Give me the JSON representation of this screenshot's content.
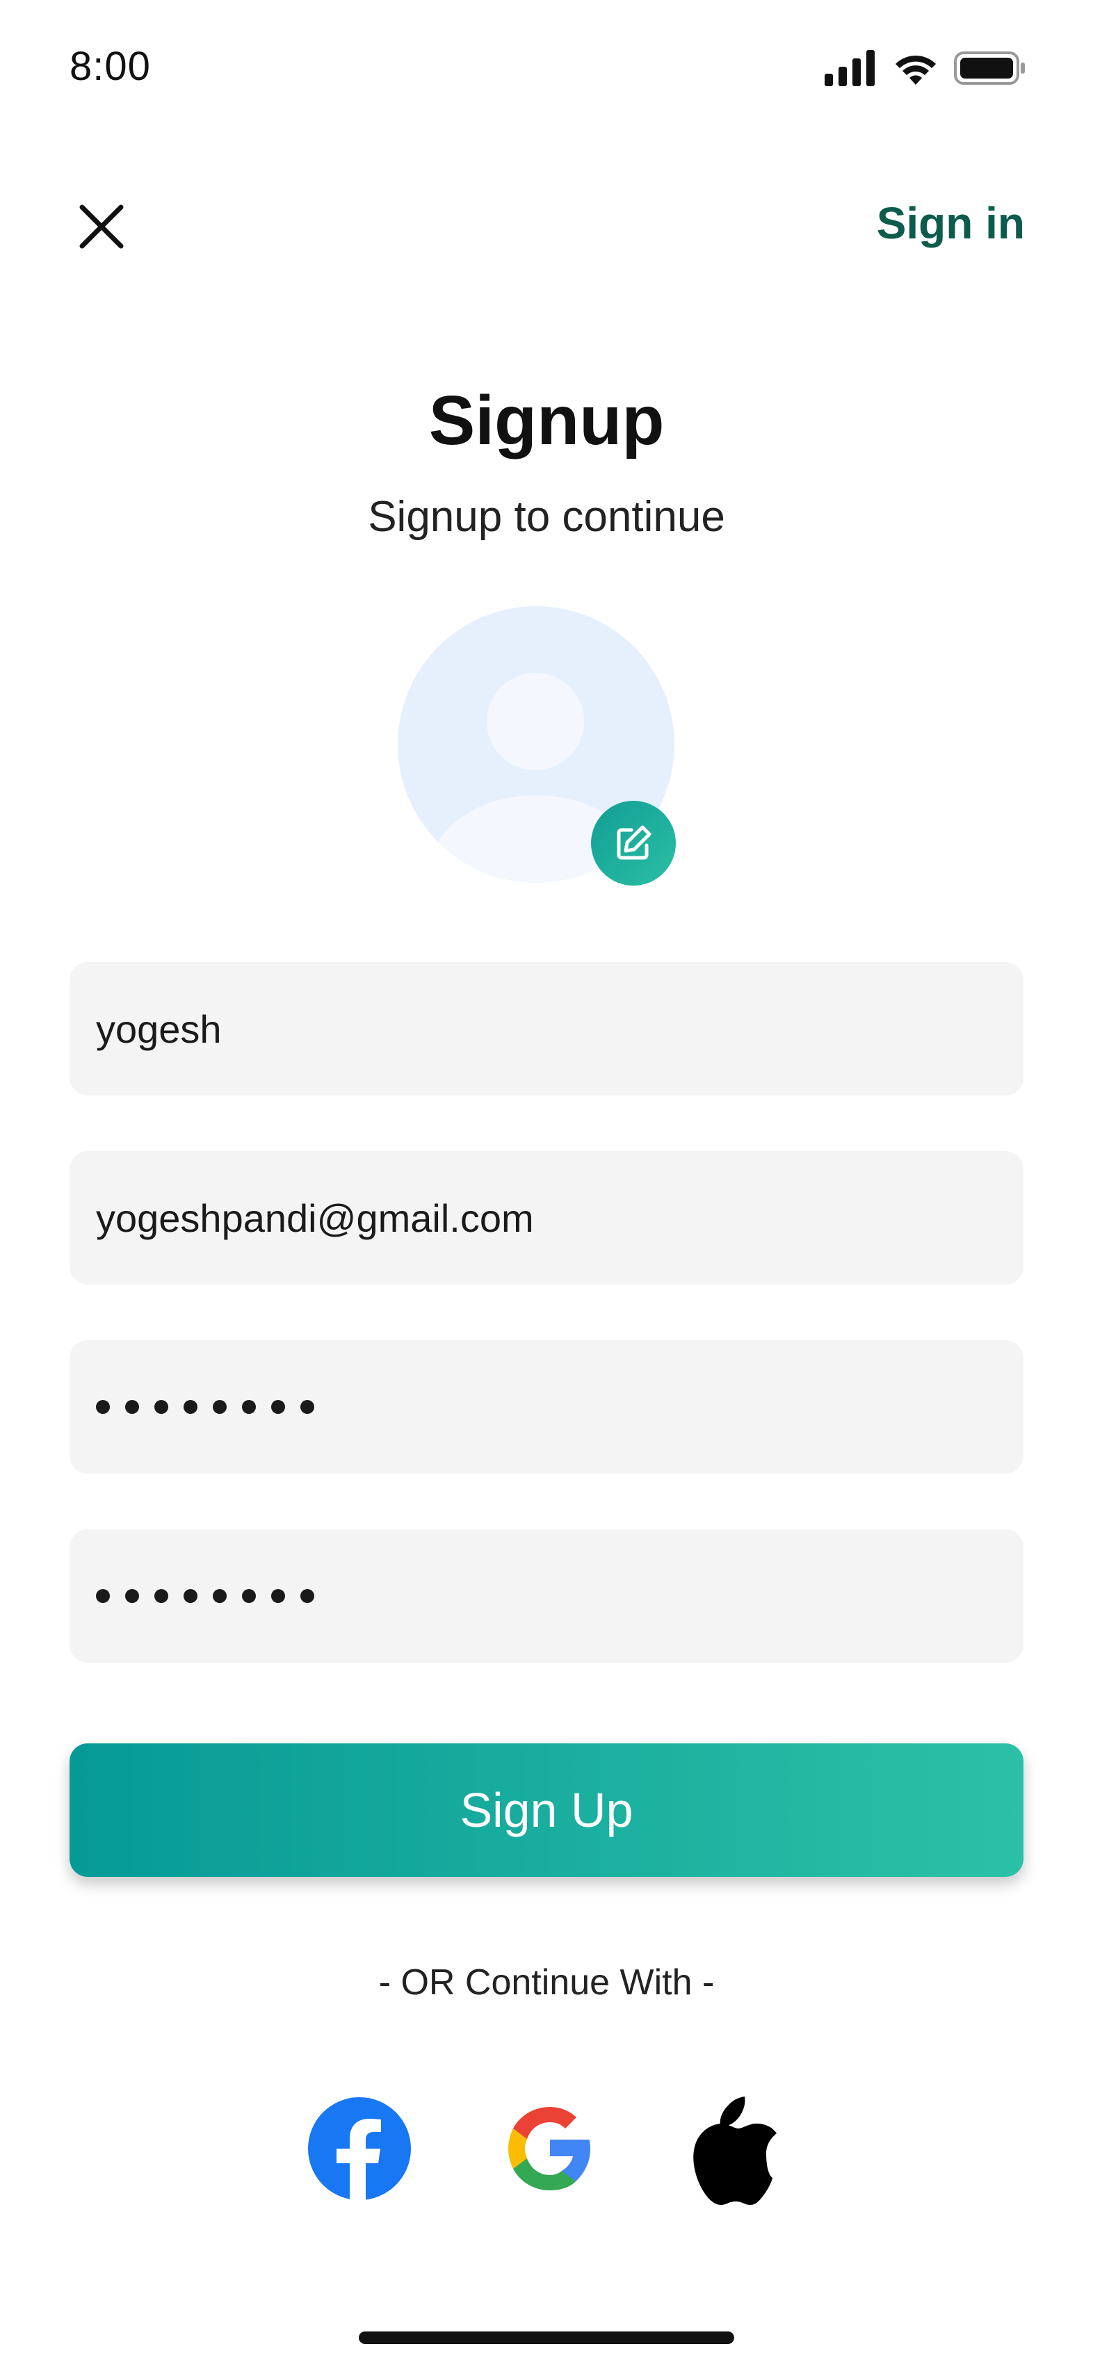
{
  "status_bar": {
    "time": "8:00",
    "icons": [
      "cellular-signal-icon",
      "wifi-icon",
      "battery-icon"
    ]
  },
  "nav": {
    "close_icon": "close-icon",
    "signin_label": "Sign in"
  },
  "header": {
    "title": "Signup",
    "subtitle": "Signup to continue"
  },
  "avatar": {
    "icon": "user-placeholder-icon",
    "edit_icon": "edit-icon"
  },
  "form": {
    "name_value": "yogesh",
    "email_value": "yogeshpandi@gmail.com",
    "password_masked_length": 8,
    "confirm_password_masked_length": 8
  },
  "actions": {
    "signup_label": "Sign Up",
    "or_text": "- OR Continue With -"
  },
  "social": [
    {
      "name": "facebook",
      "icon": "facebook-icon"
    },
    {
      "name": "google",
      "icon": "google-icon"
    },
    {
      "name": "apple",
      "icon": "apple-icon"
    }
  ],
  "colors": {
    "brand_dark": "#0d5c4b",
    "gradient_start": "#069a96",
    "gradient_end": "#2bc1a6",
    "field_bg": "#f4f4f4",
    "avatar_bg": "#e6f0fd"
  }
}
